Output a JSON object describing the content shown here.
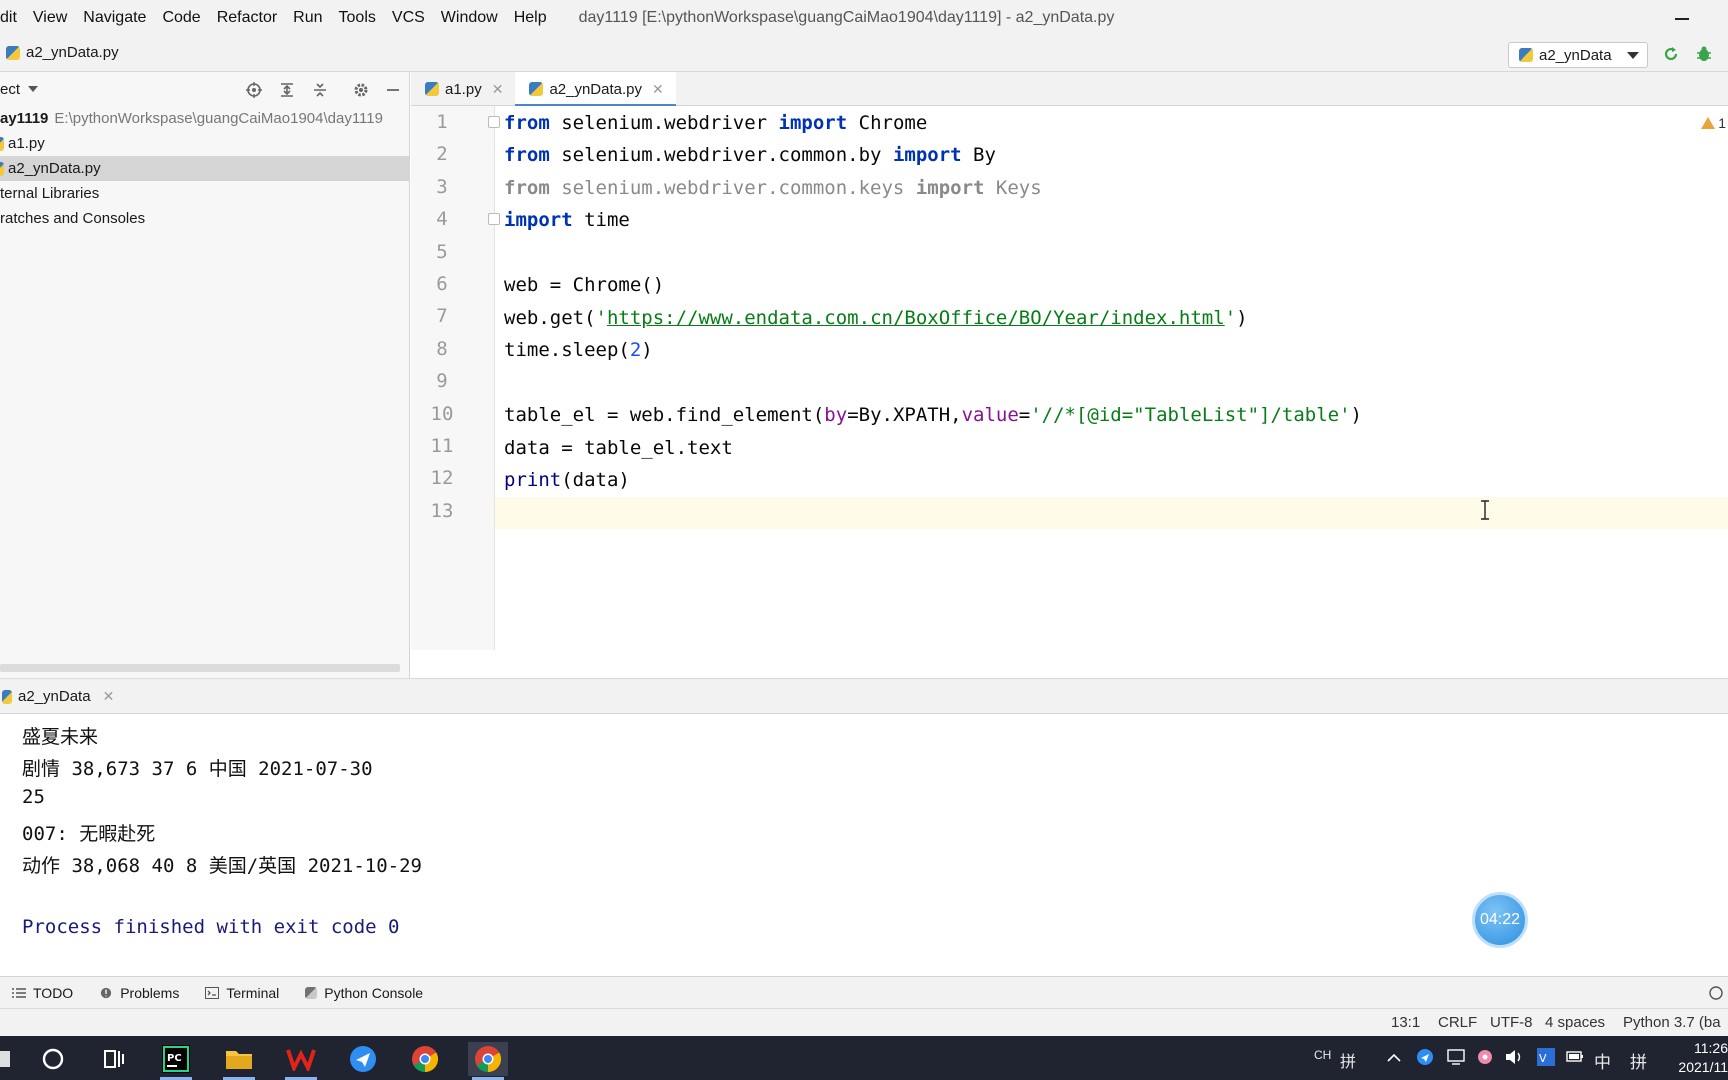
{
  "menu": {
    "items": [
      "dit",
      "View",
      "Navigate",
      "Code",
      "Refactor",
      "Run",
      "Tools",
      "VCS",
      "Window",
      "Help"
    ],
    "title": "day1119 [E:\\pythonWorkspase\\guangCaiMao1904\\day1119] - a2_ynData.py"
  },
  "navbar": {
    "file": "a2_ynData.py",
    "run_config": "a2_ynData"
  },
  "project": {
    "header": "ect",
    "tree": [
      {
        "label": "ay1119",
        "path": "E:\\pythonWorkspase\\guangCaiMao1904\\day1119"
      },
      {
        "label": "a1.py"
      },
      {
        "label": "a2_ynData.py"
      },
      {
        "label": "ternal Libraries"
      },
      {
        "label": "ratches and Consoles"
      }
    ]
  },
  "tabs": [
    {
      "label": "a1.py"
    },
    {
      "label": "a2_ynData.py"
    }
  ],
  "editor": {
    "warning_count": "1",
    "line_numbers": [
      "1",
      "2",
      "3",
      "4",
      "5",
      "6",
      "7",
      "8",
      "9",
      "10",
      "11",
      "12",
      "13"
    ],
    "line1": {
      "k1": "from",
      "t1": " selenium.webdriver ",
      "k2": "import",
      "t2": " Chrome"
    },
    "line2": {
      "k1": "from",
      "t1": " selenium.webdriver.common.by ",
      "k2": "import",
      "t2": " By"
    },
    "line3": {
      "k1": "from",
      "t1": " selenium.webdriver.common.keys ",
      "k2": "import",
      "t2": " Keys"
    },
    "line4": {
      "k1": "import",
      "t1": " time"
    },
    "line6": {
      "t1": "web = Chrome()"
    },
    "line7": {
      "t1": "web.get(",
      "q1": "'",
      "url": "https://www.endata.com.cn/BoxOffice/BO/Year/index.html",
      "q2": "'",
      "t2": ")"
    },
    "line8": {
      "t1": "time.sleep(",
      "n": "2",
      "t2": ")"
    },
    "line10": {
      "t1": "table_el = web.find_element(",
      "p1": "by",
      "t2": "=By.XPATH,",
      "p2": "value",
      "t3": "=",
      "s": "'//*[@id=\"TableList\"]/table'",
      "t4": ")"
    },
    "line11": {
      "t1": "data = table_el.text"
    },
    "line12": {
      "b": "print",
      "t1": "(data)"
    }
  },
  "run": {
    "tab": "a2_ynData",
    "output": [
      "盛夏未来",
      "剧情 38,673 37 6 中国 2021-07-30",
      "25",
      "007: 无暇赴死",
      "动作 38,068 40 8 美国/英国 2021-10-29",
      "Process finished with exit code 0"
    ],
    "timer": "04:22"
  },
  "toolwindows": [
    "TODO",
    "Problems",
    "Terminal",
    "Python Console"
  ],
  "status": {
    "position": "13:1",
    "line_sep": "CRLF",
    "encoding": "UTF-8",
    "indent": "4 spaces",
    "interpreter": "Python 3.7 (ba"
  },
  "taskbar": {
    "ime1": "CH",
    "ime2": "拼",
    "lang": "中",
    "ime3": "拼",
    "time": "11:26",
    "date": "2021/11"
  },
  "colors": {
    "keyword": "#0033b3",
    "string": "#067d17",
    "number": "#1750eb",
    "param": "#871094",
    "current_line": "#fefbe8",
    "taskbar": "#1f2430"
  }
}
